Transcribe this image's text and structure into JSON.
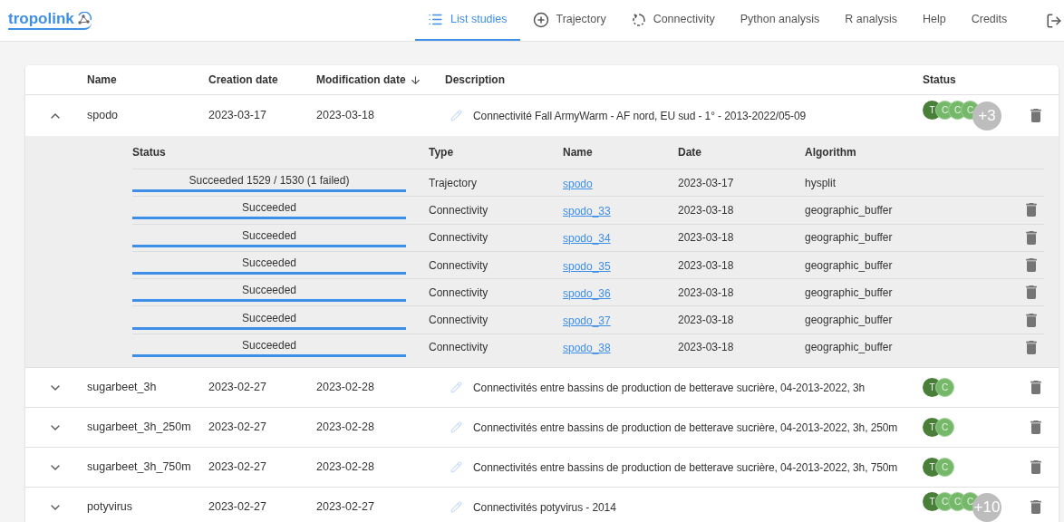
{
  "brand": {
    "name": "tropolink"
  },
  "nav": [
    {
      "label": "List studies",
      "kind": "list",
      "selected": true
    },
    {
      "label": "Trajectory",
      "kind": "add",
      "selected": false
    },
    {
      "label": "Connectivity",
      "kind": "refresh",
      "selected": false
    },
    {
      "label": "Python analysis",
      "selected": false
    },
    {
      "label": "R analysis",
      "selected": false
    },
    {
      "label": "Help",
      "selected": false
    },
    {
      "label": "Credits",
      "selected": false
    }
  ],
  "table": {
    "columns": [
      {
        "label": "Name"
      },
      {
        "label": "Creation date"
      },
      {
        "label": "Modification date",
        "sorted": true
      },
      {
        "label": "Description"
      },
      {
        "label": "Status"
      }
    ],
    "job_columns": [
      {
        "label": "Status"
      },
      {
        "label": "Type"
      },
      {
        "label": "Name"
      },
      {
        "label": "Date"
      },
      {
        "label": "Algorithm"
      }
    ],
    "rows": [
      {
        "name": "spodo",
        "created": "2023-03-17",
        "modified": "2023-03-18",
        "description": "Connectivité Fall ArmyWarm - AF nord, EU sud - 1° - 2013-2022/05-09",
        "expanded": true,
        "chips": [
          {
            "letter": "T",
            "kind": "trajectory"
          },
          {
            "letter": "C",
            "kind": "connectivity"
          },
          {
            "letter": "C",
            "kind": "connectivity"
          },
          {
            "letter": "C",
            "kind": "connectivity"
          }
        ],
        "more": "+3",
        "jobs": [
          {
            "status": "Succeeded 1529 / 1530 (1 failed)",
            "level": 1,
            "type": "Trajectory",
            "name": "spodo",
            "date": "2023-03-17",
            "algorithm": "hysplit",
            "deletable": false
          },
          {
            "status": "Succeeded",
            "level": 1,
            "type": "Connectivity",
            "name": "spodo_33",
            "date": "2023-03-18",
            "algorithm": "geographic_buffer",
            "deletable": true
          },
          {
            "status": "Succeeded",
            "level": 1,
            "type": "Connectivity",
            "name": "spodo_34",
            "date": "2023-03-18",
            "algorithm": "geographic_buffer",
            "deletable": true
          },
          {
            "status": "Succeeded",
            "level": 1,
            "type": "Connectivity",
            "name": "spodo_35",
            "date": "2023-03-18",
            "algorithm": "geographic_buffer",
            "deletable": true
          },
          {
            "status": "Succeeded",
            "level": 1,
            "type": "Connectivity",
            "name": "spodo_36",
            "date": "2023-03-18",
            "algorithm": "geographic_buffer",
            "deletable": true
          },
          {
            "status": "Succeeded",
            "level": 1,
            "type": "Connectivity",
            "name": "spodo_37",
            "date": "2023-03-18",
            "algorithm": "geographic_buffer",
            "deletable": true
          },
          {
            "status": "Succeeded",
            "level": 1,
            "type": "Connectivity",
            "name": "spodo_38",
            "date": "2023-03-18",
            "algorithm": "geographic_buffer",
            "deletable": true
          }
        ]
      },
      {
        "name": "sugarbeet_3h",
        "created": "2023-02-27",
        "modified": "2023-02-28",
        "description": "Connectivités entre bassins de production de betterave sucrière, 04-2013-2022, 3h",
        "expanded": false,
        "chips": [
          {
            "letter": "T",
            "kind": "trajectory"
          },
          {
            "letter": "C",
            "kind": "connectivity"
          }
        ]
      },
      {
        "name": "sugarbeet_3h_250m",
        "created": "2023-02-27",
        "modified": "2023-02-28",
        "description": "Connectivités entre bassins de production de betterave sucrière, 04-2013-2022, 3h, 250m",
        "expanded": false,
        "chips": [
          {
            "letter": "T",
            "kind": "trajectory"
          },
          {
            "letter": "C",
            "kind": "connectivity"
          }
        ]
      },
      {
        "name": "sugarbeet_3h_750m",
        "created": "2023-02-27",
        "modified": "2023-02-28",
        "description": "Connectivités entre bassins de production de betterave sucrière, 04-2013-2022, 3h, 750m",
        "expanded": false,
        "chips": [
          {
            "letter": "T",
            "kind": "trajectory"
          },
          {
            "letter": "C",
            "kind": "connectivity"
          }
        ]
      },
      {
        "name": "potyvirus",
        "created": "2023-02-27",
        "modified": "2023-02-27",
        "description": "Connectivités potyvirus - 2014",
        "expanded": false,
        "chips": [
          {
            "letter": "T",
            "kind": "trajectory"
          },
          {
            "letter": "C",
            "kind": "connectivity"
          },
          {
            "letter": "C",
            "kind": "connectivity"
          },
          {
            "letter": "C",
            "kind": "connectivity"
          }
        ],
        "more": "+10"
      }
    ]
  }
}
